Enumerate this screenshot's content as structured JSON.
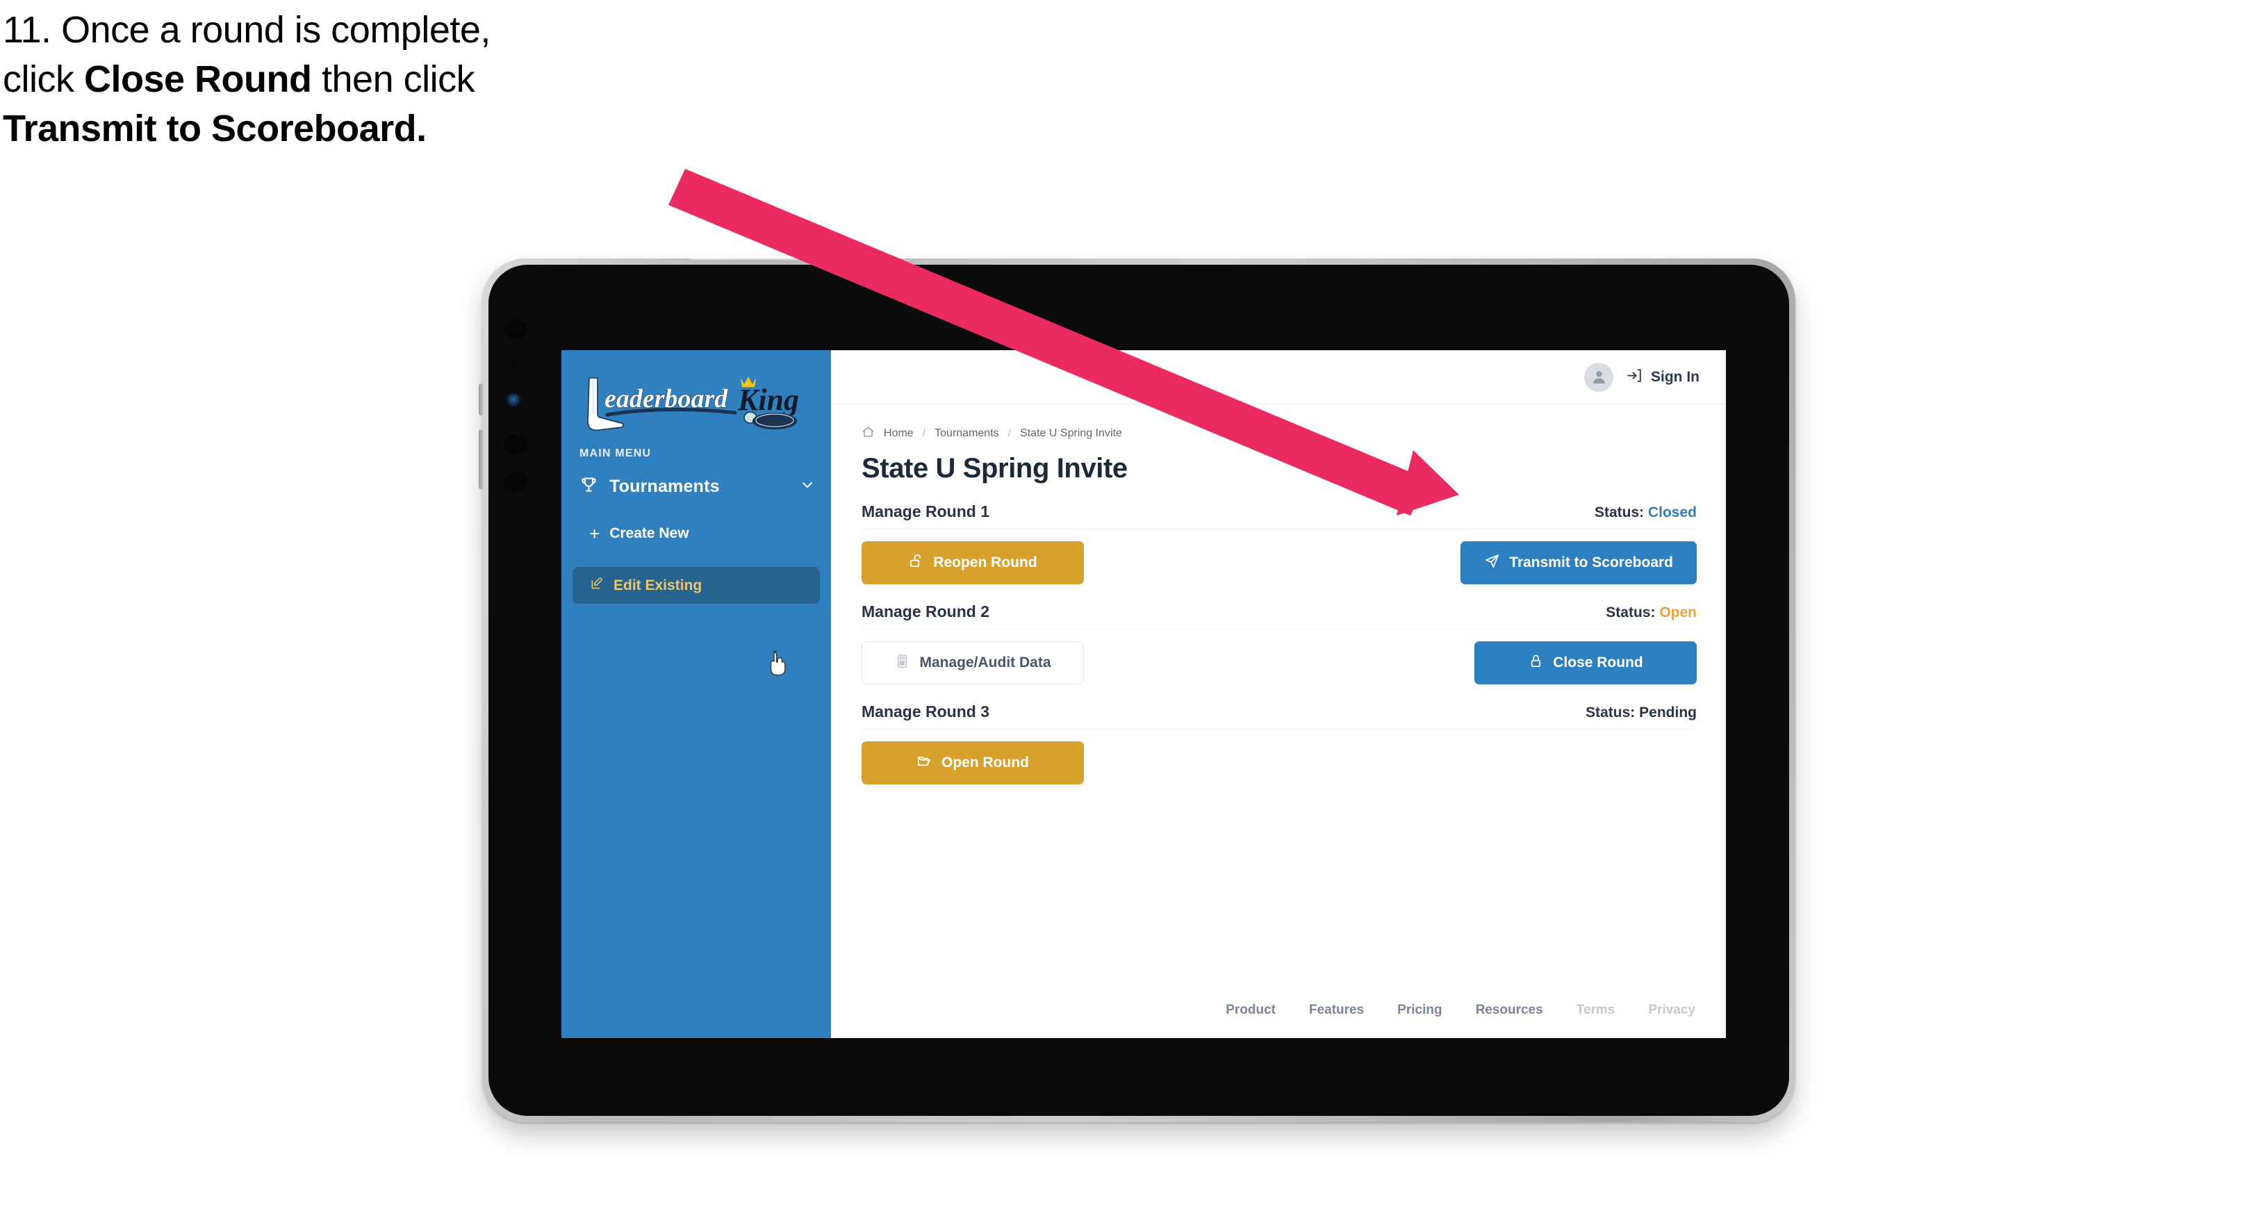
{
  "caption": {
    "lines": [
      {
        "parts": [
          {
            "text": "11. Once a round is complete,",
            "bold": false
          }
        ]
      },
      {
        "parts": [
          {
            "text": "click ",
            "bold": false
          },
          {
            "text": "Close Round",
            "bold": true
          },
          {
            "text": " then click",
            "bold": false
          }
        ]
      },
      {
        "parts": [
          {
            "text": "Transmit to Scoreboard.",
            "bold": true
          }
        ]
      }
    ],
    "line1": "11. Once a round is complete,",
    "line2_pre": "click ",
    "line2_bold": "Close Round",
    "line2_post": " then click",
    "line3_bold": "Transmit to Scoreboard."
  },
  "sidebar": {
    "logo_text": "LeaderboardKing",
    "logo_word1": "Leaderboard",
    "logo_word2": "King",
    "section_label": "MAIN MENU",
    "nav": {
      "label": "Tournaments",
      "icon": "trophy-icon",
      "chevron": "chevron-down-icon"
    },
    "items": [
      {
        "label": "Create New",
        "icon": "plus-icon",
        "active": false
      },
      {
        "label": "Edit Existing",
        "icon": "edit-pencil-icon",
        "active": true
      }
    ]
  },
  "topbar": {
    "avatar_icon": "user-avatar-icon",
    "signin_icon": "sign-in-arrow-icon",
    "signin_label": "Sign In"
  },
  "breadcrumb": {
    "home_icon": "home-icon",
    "items": [
      "Home",
      "Tournaments",
      "State U Spring Invite"
    ],
    "separator": "/"
  },
  "page": {
    "title": "State U Spring Invite"
  },
  "rounds": [
    {
      "name": "Manage Round 1",
      "status_label": "Status:",
      "status_value": "Closed",
      "status_kind": "closed",
      "left_button": {
        "label": "Reopen Round",
        "icon": "unlock-icon",
        "style": "gold"
      },
      "right_button": {
        "label": "Transmit to Scoreboard",
        "icon": "paper-plane-icon",
        "style": "blue"
      }
    },
    {
      "name": "Manage Round 2",
      "status_label": "Status:",
      "status_value": "Open",
      "status_kind": "open",
      "left_button": {
        "label": "Manage/Audit Data",
        "icon": "calculator-icon",
        "style": "ghost"
      },
      "right_button": {
        "label": "Close Round",
        "icon": "lock-icon",
        "style": "blue"
      }
    },
    {
      "name": "Manage Round 3",
      "status_label": "Status:",
      "status_value": "Pending",
      "status_kind": "pending",
      "left_button": {
        "label": "Open Round",
        "icon": "open-folder-icon",
        "style": "gold"
      },
      "right_button": null
    }
  ],
  "footer": {
    "links": [
      {
        "label": "Product",
        "dim": false
      },
      {
        "label": "Features",
        "dim": false
      },
      {
        "label": "Pricing",
        "dim": false
      },
      {
        "label": "Resources",
        "dim": false
      },
      {
        "label": "Terms",
        "dim": true
      },
      {
        "label": "Privacy",
        "dim": true
      }
    ]
  },
  "annotation": {
    "arrow_color": "#ec2a62",
    "points_to": "Transmit to Scoreboard"
  },
  "colors": {
    "sidebar_blue": "#3080bf",
    "sidebar_active": "#26638f",
    "active_text_gold": "#ecc774",
    "button_gold": "#d8a02c",
    "button_blue": "#2d7fbf",
    "status_open": "#e8a33d",
    "status_closed": "#2f7fc0",
    "title_dark": "#1d2838",
    "arrow_pink": "#ec2a62"
  },
  "cursor": {
    "type": "pointing-hand"
  }
}
